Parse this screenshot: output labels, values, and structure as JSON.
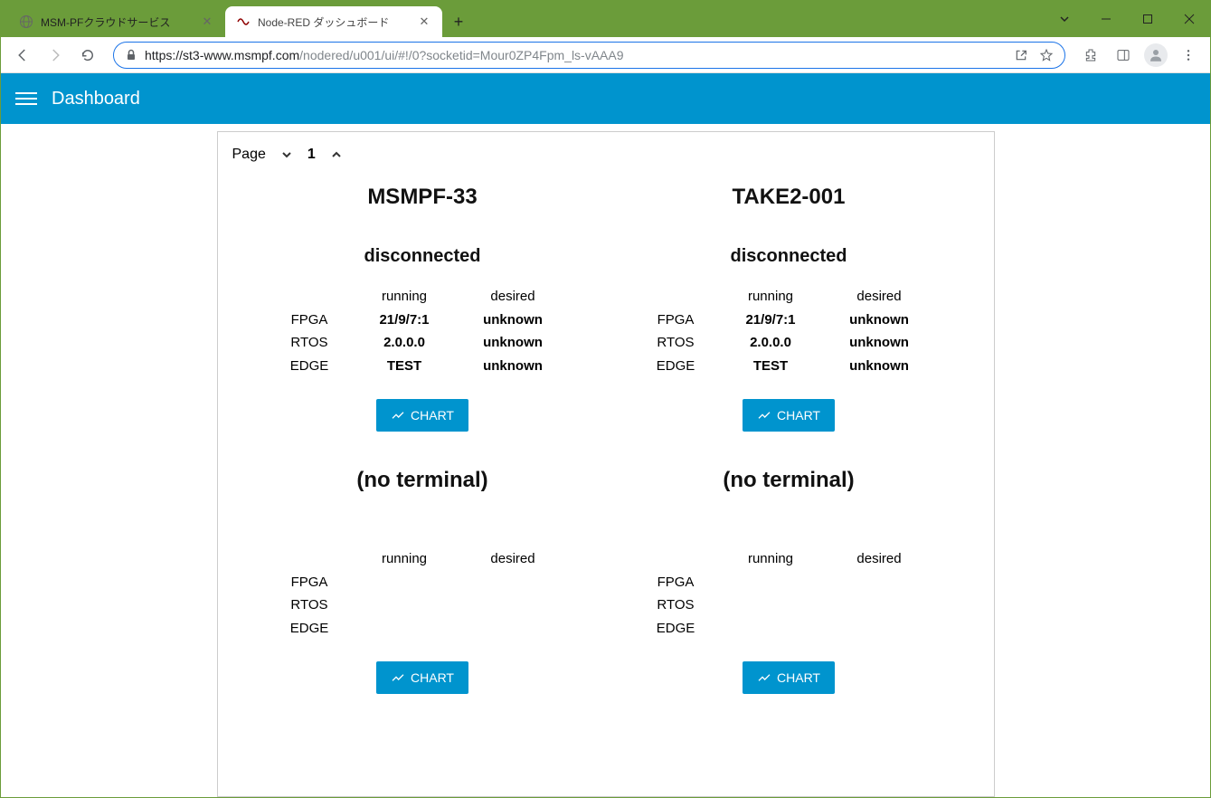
{
  "browser": {
    "tabs": [
      {
        "title": "MSM-PFクラウドサービス",
        "active": false
      },
      {
        "title": "Node-RED ダッシュボード",
        "active": true
      }
    ],
    "url_host": "https://st3-www.msmpf.com",
    "url_path": "/nodered/u001/ui/#!/0?socketid=Mour0ZP4Fpm_ls-vAAA9"
  },
  "app": {
    "title": "Dashboard",
    "pager_label": "Page",
    "pager_value": "1"
  },
  "columns": {
    "running": "running",
    "desired": "desired"
  },
  "row_labels": {
    "fpga": "FPGA",
    "rtos": "RTOS",
    "edge": "EDGE"
  },
  "chart_button_label": "CHART",
  "devices": [
    {
      "name": "MSMPF-33",
      "status": "disconnected",
      "fpga_running": "21/9/7:1",
      "fpga_desired": "unknown",
      "rtos_running": "2.0.0.0",
      "rtos_desired": "unknown",
      "edge_running": "TEST",
      "edge_desired": "unknown"
    },
    {
      "name": "TAKE2-001",
      "status": "disconnected",
      "fpga_running": "21/9/7:1",
      "fpga_desired": "unknown",
      "rtos_running": "2.0.0.0",
      "rtos_desired": "unknown",
      "edge_running": "TEST",
      "edge_desired": "unknown"
    },
    {
      "name": "(no terminal)",
      "status": "",
      "fpga_running": "",
      "fpga_desired": "",
      "rtos_running": "",
      "rtos_desired": "",
      "edge_running": "",
      "edge_desired": ""
    },
    {
      "name": "(no terminal)",
      "status": "",
      "fpga_running": "",
      "fpga_desired": "",
      "rtos_running": "",
      "rtos_desired": "",
      "edge_running": "",
      "edge_desired": ""
    }
  ]
}
